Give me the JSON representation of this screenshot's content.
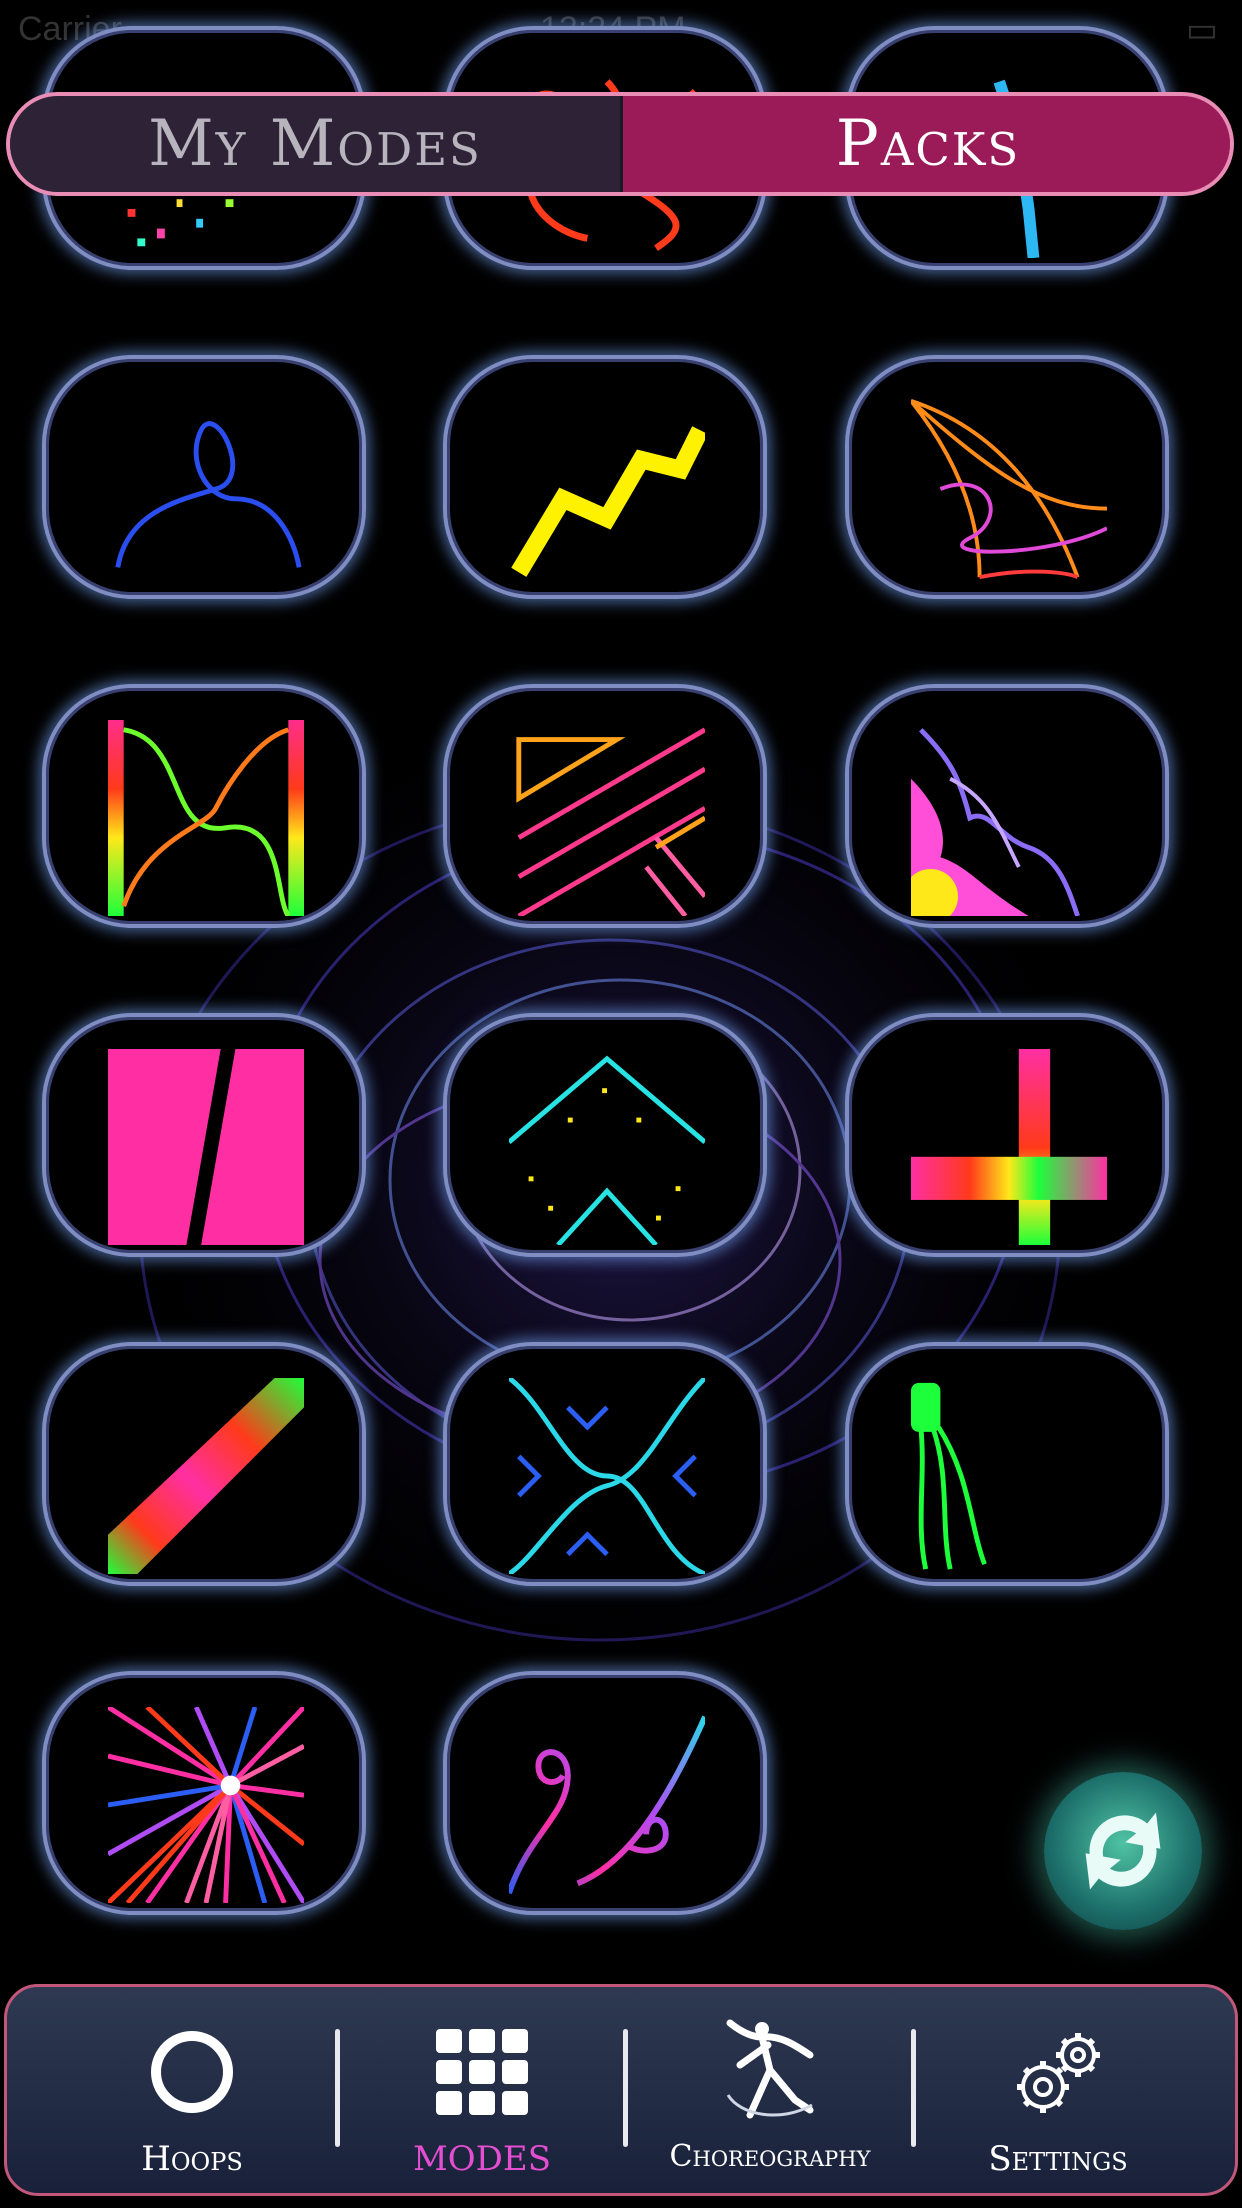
{
  "status_bar": {
    "carrier": "Carrier",
    "time": "12:24 PM"
  },
  "segment": {
    "my_modes_label": "My Modes",
    "packs_label": "Packs",
    "selected": "Packs"
  },
  "mode_tiles": [
    {
      "icon": "confetti-dots-icon"
    },
    {
      "icon": "red-scribble-icon"
    },
    {
      "icon": "blue-stroke-icon"
    },
    {
      "icon": "blue-loop-icon"
    },
    {
      "icon": "yellow-zigzag-icon"
    },
    {
      "icon": "rainbow-fan-icon"
    },
    {
      "icon": "rainbow-wave-bars-icon"
    },
    {
      "icon": "pink-orange-stripes-icon"
    },
    {
      "icon": "pink-flame-icon"
    },
    {
      "icon": "pink-block-slash-icon"
    },
    {
      "icon": "cyan-chevrons-icon"
    },
    {
      "icon": "rainbow-cross-icon"
    },
    {
      "icon": "rainbow-diagonal-icon"
    },
    {
      "icon": "cyan-x-arrows-icon"
    },
    {
      "icon": "green-drip-icon"
    },
    {
      "icon": "rainbow-starburst-icon"
    },
    {
      "icon": "rainbow-swirl-icon"
    }
  ],
  "refresh_button": {
    "icon": "refresh-icon",
    "color": "#2a8f7f"
  },
  "nav": {
    "items": [
      {
        "label": "Hoops",
        "icon": "hoop-ring-icon",
        "active": false
      },
      {
        "label": "MODES",
        "icon": "grid-icon",
        "active": true
      },
      {
        "label": "Choreography",
        "icon": "dancer-icon",
        "active": false
      },
      {
        "label": "Settings",
        "icon": "gears-icon",
        "active": false
      }
    ],
    "active_color": "#e44fd2"
  }
}
